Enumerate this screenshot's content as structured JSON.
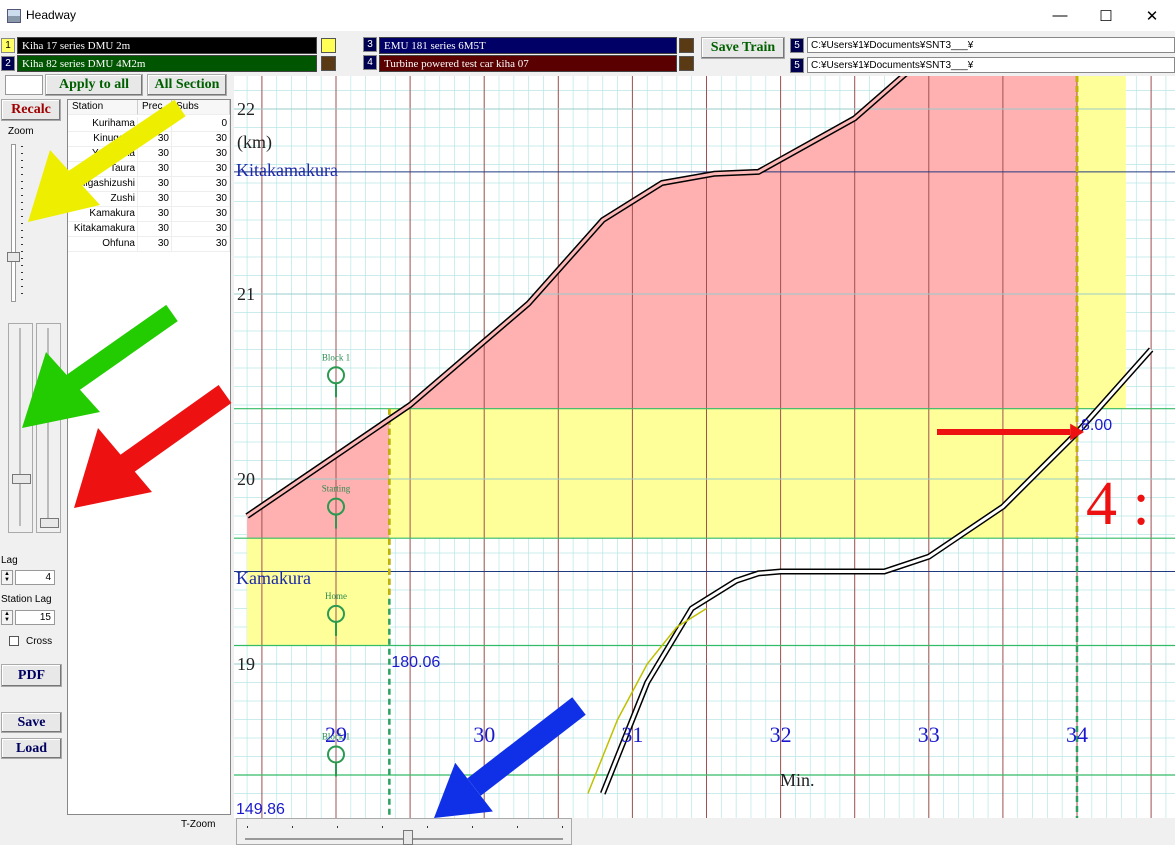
{
  "window": {
    "title": "Headway",
    "minimize": "—",
    "maximize": "☐",
    "close": "✕"
  },
  "trains": [
    {
      "num": "1",
      "name": "Kiha 17 series DMU 2m",
      "bg": "#000000",
      "numBg": "#ffff66",
      "swatch": "#ffff55"
    },
    {
      "num": "2",
      "name": "Kiha 82 series DMU  4M2m",
      "bg": "#005500",
      "numBg": "#000050",
      "swatch": "#5a3a14"
    },
    {
      "num": "3",
      "name": "EMU 181 series  6M5T",
      "bg": "#000066",
      "numBg": "#000050",
      "swatch": "#5a3a14"
    },
    {
      "num": "4",
      "name": "Turbine powered test car kiha 07",
      "bg": "#5a0000",
      "numBg": "#000050",
      "swatch": "#5a3a14"
    }
  ],
  "toolbar": {
    "save_train": "Save Train",
    "apply_all": "Apply to all",
    "all_section": "All Section",
    "recalc": "Recalc"
  },
  "paths": [
    {
      "num": "5",
      "value": "C:¥Users¥1¥Documents¥SNT3___¥"
    },
    {
      "num": "5",
      "value": "C:¥Users¥1¥Documents¥SNT3___¥"
    }
  ],
  "left": {
    "zoom": "Zoom",
    "lag": "Lag",
    "lag_value": "4",
    "station_lag": "Station Lag",
    "station_lag_value": "15",
    "cross": "Cross",
    "pdf": "PDF",
    "save": "Save",
    "load": "Load",
    "tzoom": "T-Zoom"
  },
  "table": {
    "headers": [
      "Station",
      "Prec",
      "Subs"
    ],
    "rows": [
      [
        "Kurihama",
        "",
        "0"
      ],
      [
        "Kinugasa",
        "30",
        "30"
      ],
      [
        "Yokosuka",
        "30",
        "30"
      ],
      [
        "Taura",
        "30",
        "30"
      ],
      [
        "Higashizushi",
        "30",
        "30"
      ],
      [
        "Zushi",
        "30",
        "30"
      ],
      [
        "Kamakura",
        "30",
        "30"
      ],
      [
        "Kitakamakura",
        "30",
        "30"
      ],
      [
        "Ohfuna",
        "30",
        "30"
      ]
    ]
  },
  "chart": {
    "y_unit": "(km)",
    "x_unit": "Min.",
    "km_labels": [
      "22",
      "21",
      "20",
      "19"
    ],
    "minute_labels": [
      "29",
      "30",
      "31",
      "32",
      "33",
      "34"
    ],
    "stations": [
      "Kitakamakura",
      "Kamakura"
    ],
    "signals": [
      "Block 1",
      "Starting",
      "Home",
      "Block 1"
    ],
    "readouts": [
      "180.06",
      "149.86",
      "8.00"
    ],
    "big_label": "4 :",
    "colors": {
      "red_zone": "#ffb0b0",
      "yellow_zone": "#ffff99",
      "grid": "#b8e6e6",
      "station_line": "#203a80",
      "signal_line": "#33bb66"
    }
  },
  "chart_data": {
    "type": "line",
    "xlabel": "Min.",
    "ylabel": "(km)",
    "xlim": [
      28.4,
      34.6
    ],
    "ylim": [
      18.3,
      22.2
    ],
    "series": [
      {
        "x": [
          28.4,
          29.5,
          30.3,
          30.8,
          31.2,
          31.55,
          31.85,
          32.5,
          33.0,
          33.5
        ],
        "y": [
          19.8,
          20.4,
          20.95,
          21.4,
          21.6,
          21.65,
          21.66,
          21.95,
          22.3,
          22.6
        ]
      },
      {
        "x": [
          30.8,
          31.1,
          31.4,
          31.7,
          31.85,
          32.0,
          32.7,
          33.0,
          33.5,
          34.0,
          34.5
        ],
        "y": [
          18.3,
          18.9,
          19.3,
          19.45,
          19.49,
          19.5,
          19.5,
          19.58,
          19.85,
          20.25,
          20.7
        ]
      },
      {
        "x": [
          30.7,
          30.9,
          31.1,
          31.3,
          31.5
        ],
        "y": [
          18.3,
          18.7,
          19.0,
          19.2,
          19.3
        ]
      }
    ]
  }
}
